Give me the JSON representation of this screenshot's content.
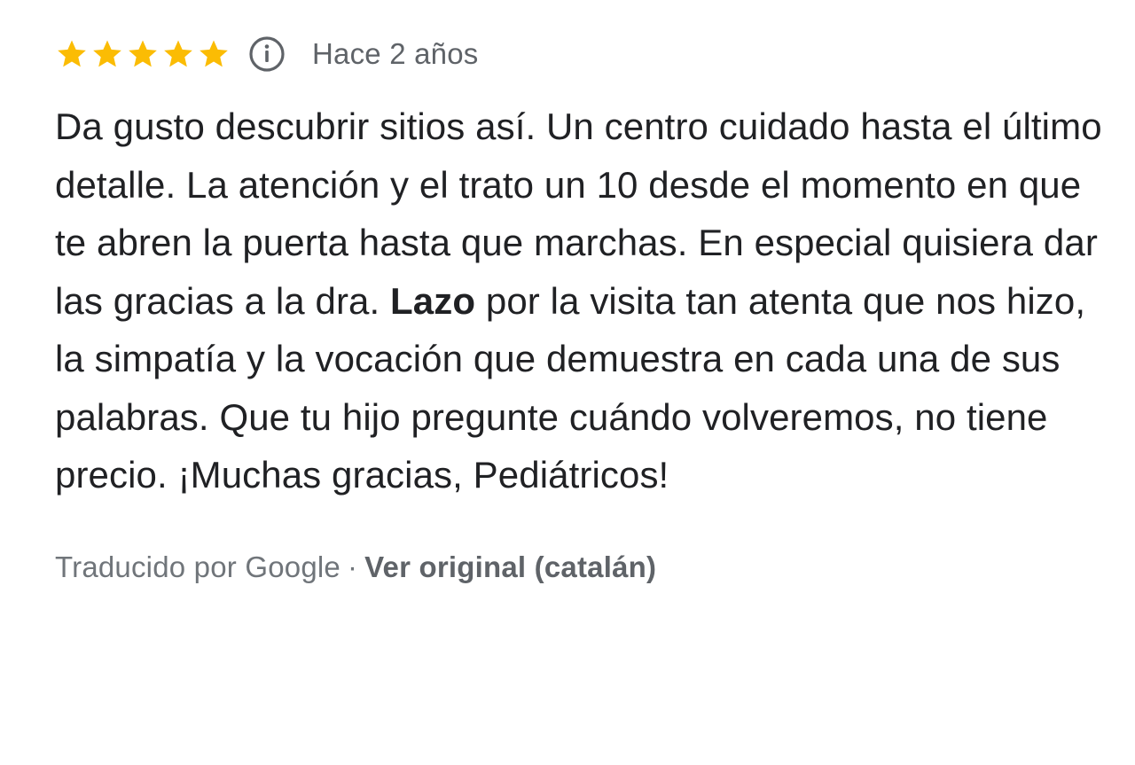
{
  "review": {
    "rating": 5,
    "rating_max": 5,
    "star_color": "#FBBC04",
    "info_icon": "info-icon",
    "time_ago": "Hace 2 años",
    "text_part1": "Da gusto descubrir sitios así. Un centro cuidado hasta el último detalle. La atención y el trato un 10 desde el momento en que te abren la puerta hasta que marchas. En especial quisiera dar las gracias a la dra. ",
    "text_highlight": "Lazo",
    "text_part2": " por la visita tan atenta que nos hizo, la simpatía y la vocación que demuestra en cada una de sus palabras. Que tu hijo pregunte cuándo volveremos, no tiene precio.  ¡Muchas gracias, Pediátricos!",
    "translated_by": "Traducido por Google",
    "separator": "·",
    "view_original": "Ver original (catalán)"
  }
}
